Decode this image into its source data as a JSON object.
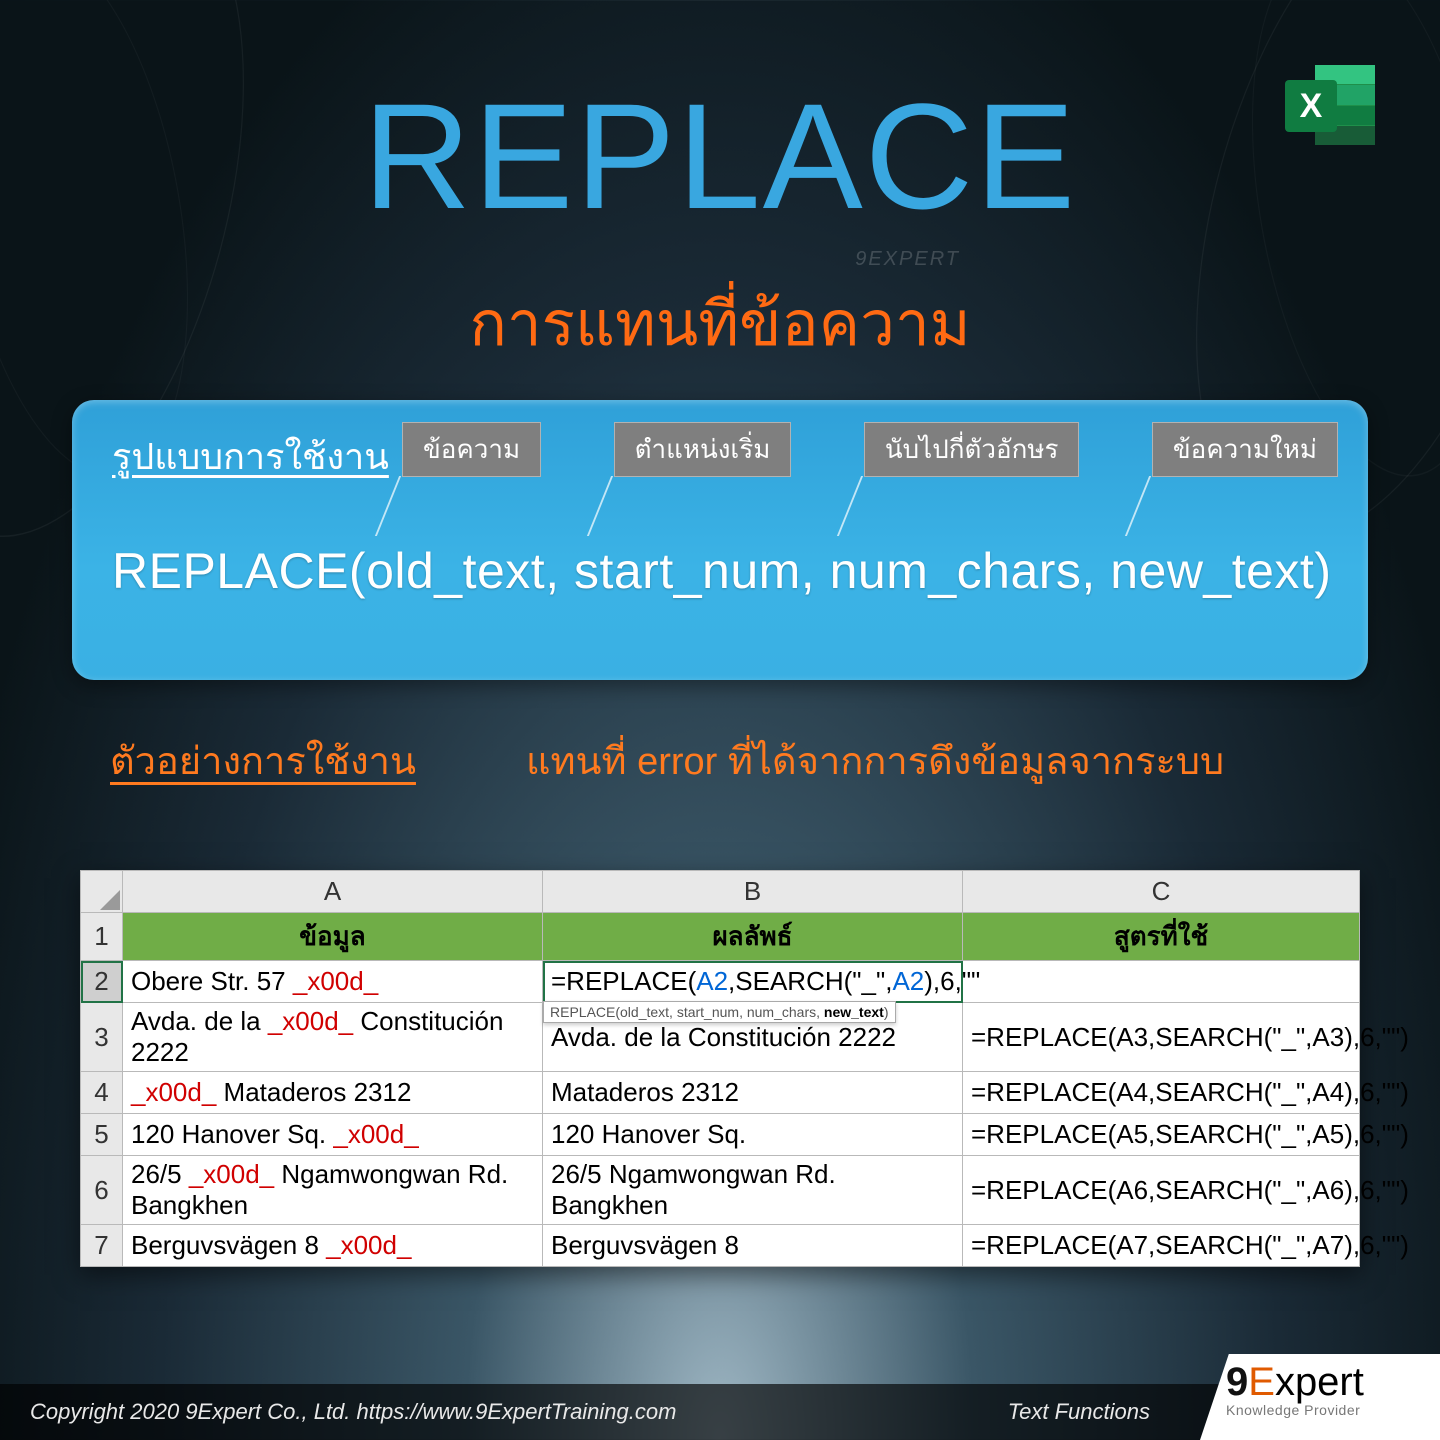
{
  "title": "REPLACE",
  "watermark": "9EXPERT",
  "subtitle": "การแทนที่ข้อความ",
  "panel": {
    "usage_label": "รูปแบบการใช้งาน",
    "args": [
      "ข้อความ",
      "ตำแหน่งเริ่ม",
      "นับไปกี่ตัวอักษร",
      "ข้อความใหม่"
    ],
    "syntax": "REPLACE(old_text, start_num, num_chars, new_text)"
  },
  "example": {
    "label": "ตัวอย่างการใช้งาน",
    "desc": "แทนที่ error ที่ได้จากการดึงข้อมูลจากระบบ"
  },
  "sheet": {
    "cols": [
      "A",
      "B",
      "C"
    ],
    "headers": [
      "ข้อมูล",
      "ผลลัพธ์",
      "สูตรที่ใช้"
    ],
    "tooltip_plain": "REPLACE(old_text, start_num, num_chars, ",
    "tooltip_bold": "new_text",
    "tooltip_tail": ")",
    "editing_prefix": "=REPLACE(",
    "editing_ref1": "A2",
    "editing_mid": ",SEARCH(\"_\",",
    "editing_ref2": "A2",
    "editing_suffix": "),6,\"\"",
    "rows": [
      {
        "n": "2",
        "a_pre": "Obere Str. 57 ",
        "a_err": "_x00d_",
        "a_post": "",
        "b_covered": "",
        "c": ""
      },
      {
        "n": "3",
        "a_pre": "Avda. de la ",
        "a_err": "_x00d_",
        "a_post": " Constitución 2222",
        "b": "Avda. de la  Constitución 2222",
        "c": "=REPLACE(A3,SEARCH(\"_\",A3),6,\"\")"
      },
      {
        "n": "4",
        "a_pre": "",
        "a_err": "_x00d_",
        "a_post": " Mataderos  2312",
        "b": "Mataderos  2312",
        "c": "=REPLACE(A4,SEARCH(\"_\",A4),6,\"\")"
      },
      {
        "n": "5",
        "a_pre": "120 Hanover Sq. ",
        "a_err": "_x00d_",
        "a_post": "",
        "b": "120 Hanover Sq.",
        "c": "=REPLACE(A5,SEARCH(\"_\",A5),6,\"\")"
      },
      {
        "n": "6",
        "a_pre": "26/5 ",
        "a_err": "_x00d_",
        "a_post": " Ngamwongwan Rd. Bangkhen",
        "b": "26/5  Ngamwongwan Rd. Bangkhen",
        "c": "=REPLACE(A6,SEARCH(\"_\",A6),6,\"\")"
      },
      {
        "n": "7",
        "a_pre": "Berguvsvägen  8 ",
        "a_err": "_x00d_",
        "a_post": "",
        "b": "Berguvsvägen  8",
        "c": "=REPLACE(A7,SEARCH(\"_\",A7),6,\"\")"
      }
    ]
  },
  "footer": {
    "copyright": "Copyright 2020 9Expert Co., Ltd.   https://www.9ExpertTraining.com",
    "category": "Text Functions",
    "brand_9": "9",
    "brand_e": "E",
    "brand_rest": "xpert",
    "brand_tag": "Knowledge Provider"
  }
}
